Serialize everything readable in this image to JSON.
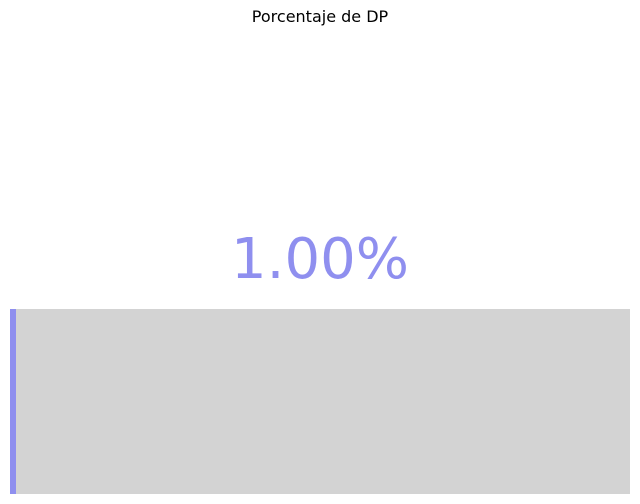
{
  "chart_data": {
    "type": "bar",
    "title": "Porcentaje de DP",
    "value_label": "1.00%",
    "values": [
      1.0
    ],
    "xlim": [
      0,
      100
    ],
    "unit": "%",
    "colors": {
      "fill": "#8f8fef",
      "track": "#d3d3d3",
      "value_text": "#8f8fef"
    },
    "grid": false
  }
}
